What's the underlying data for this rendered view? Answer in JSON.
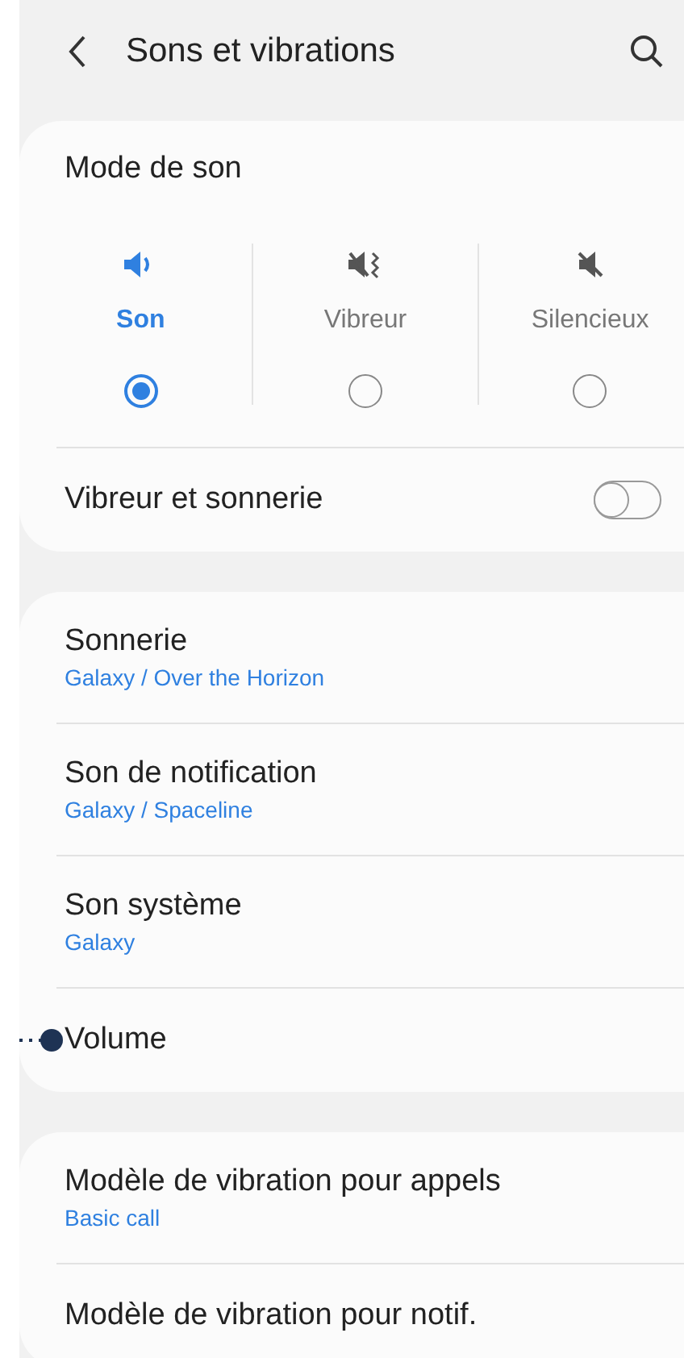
{
  "header": {
    "title": "Sons et vibrations"
  },
  "sound_mode": {
    "title": "Mode de son",
    "options": [
      {
        "kind": "sound",
        "label": "Son",
        "selected": true
      },
      {
        "kind": "vibrate",
        "label": "Vibreur",
        "selected": false
      },
      {
        "kind": "mute",
        "label": "Silencieux",
        "selected": false
      }
    ],
    "vibrate_and_ring": {
      "label": "Vibreur et sonnerie",
      "on": false
    }
  },
  "groups": [
    {
      "items": [
        {
          "title": "Sonnerie",
          "subtitle": "Galaxy / Over the Horizon"
        },
        {
          "title": "Son de notification",
          "subtitle": "Galaxy / Spaceline"
        },
        {
          "title": "Son système",
          "subtitle": "Galaxy"
        },
        {
          "title": "Volume",
          "annotated": true
        }
      ]
    },
    {
      "items": [
        {
          "title": "Modèle de vibration pour appels",
          "subtitle": "Basic call"
        },
        {
          "title": "Modèle de vibration pour notif."
        }
      ]
    }
  ]
}
